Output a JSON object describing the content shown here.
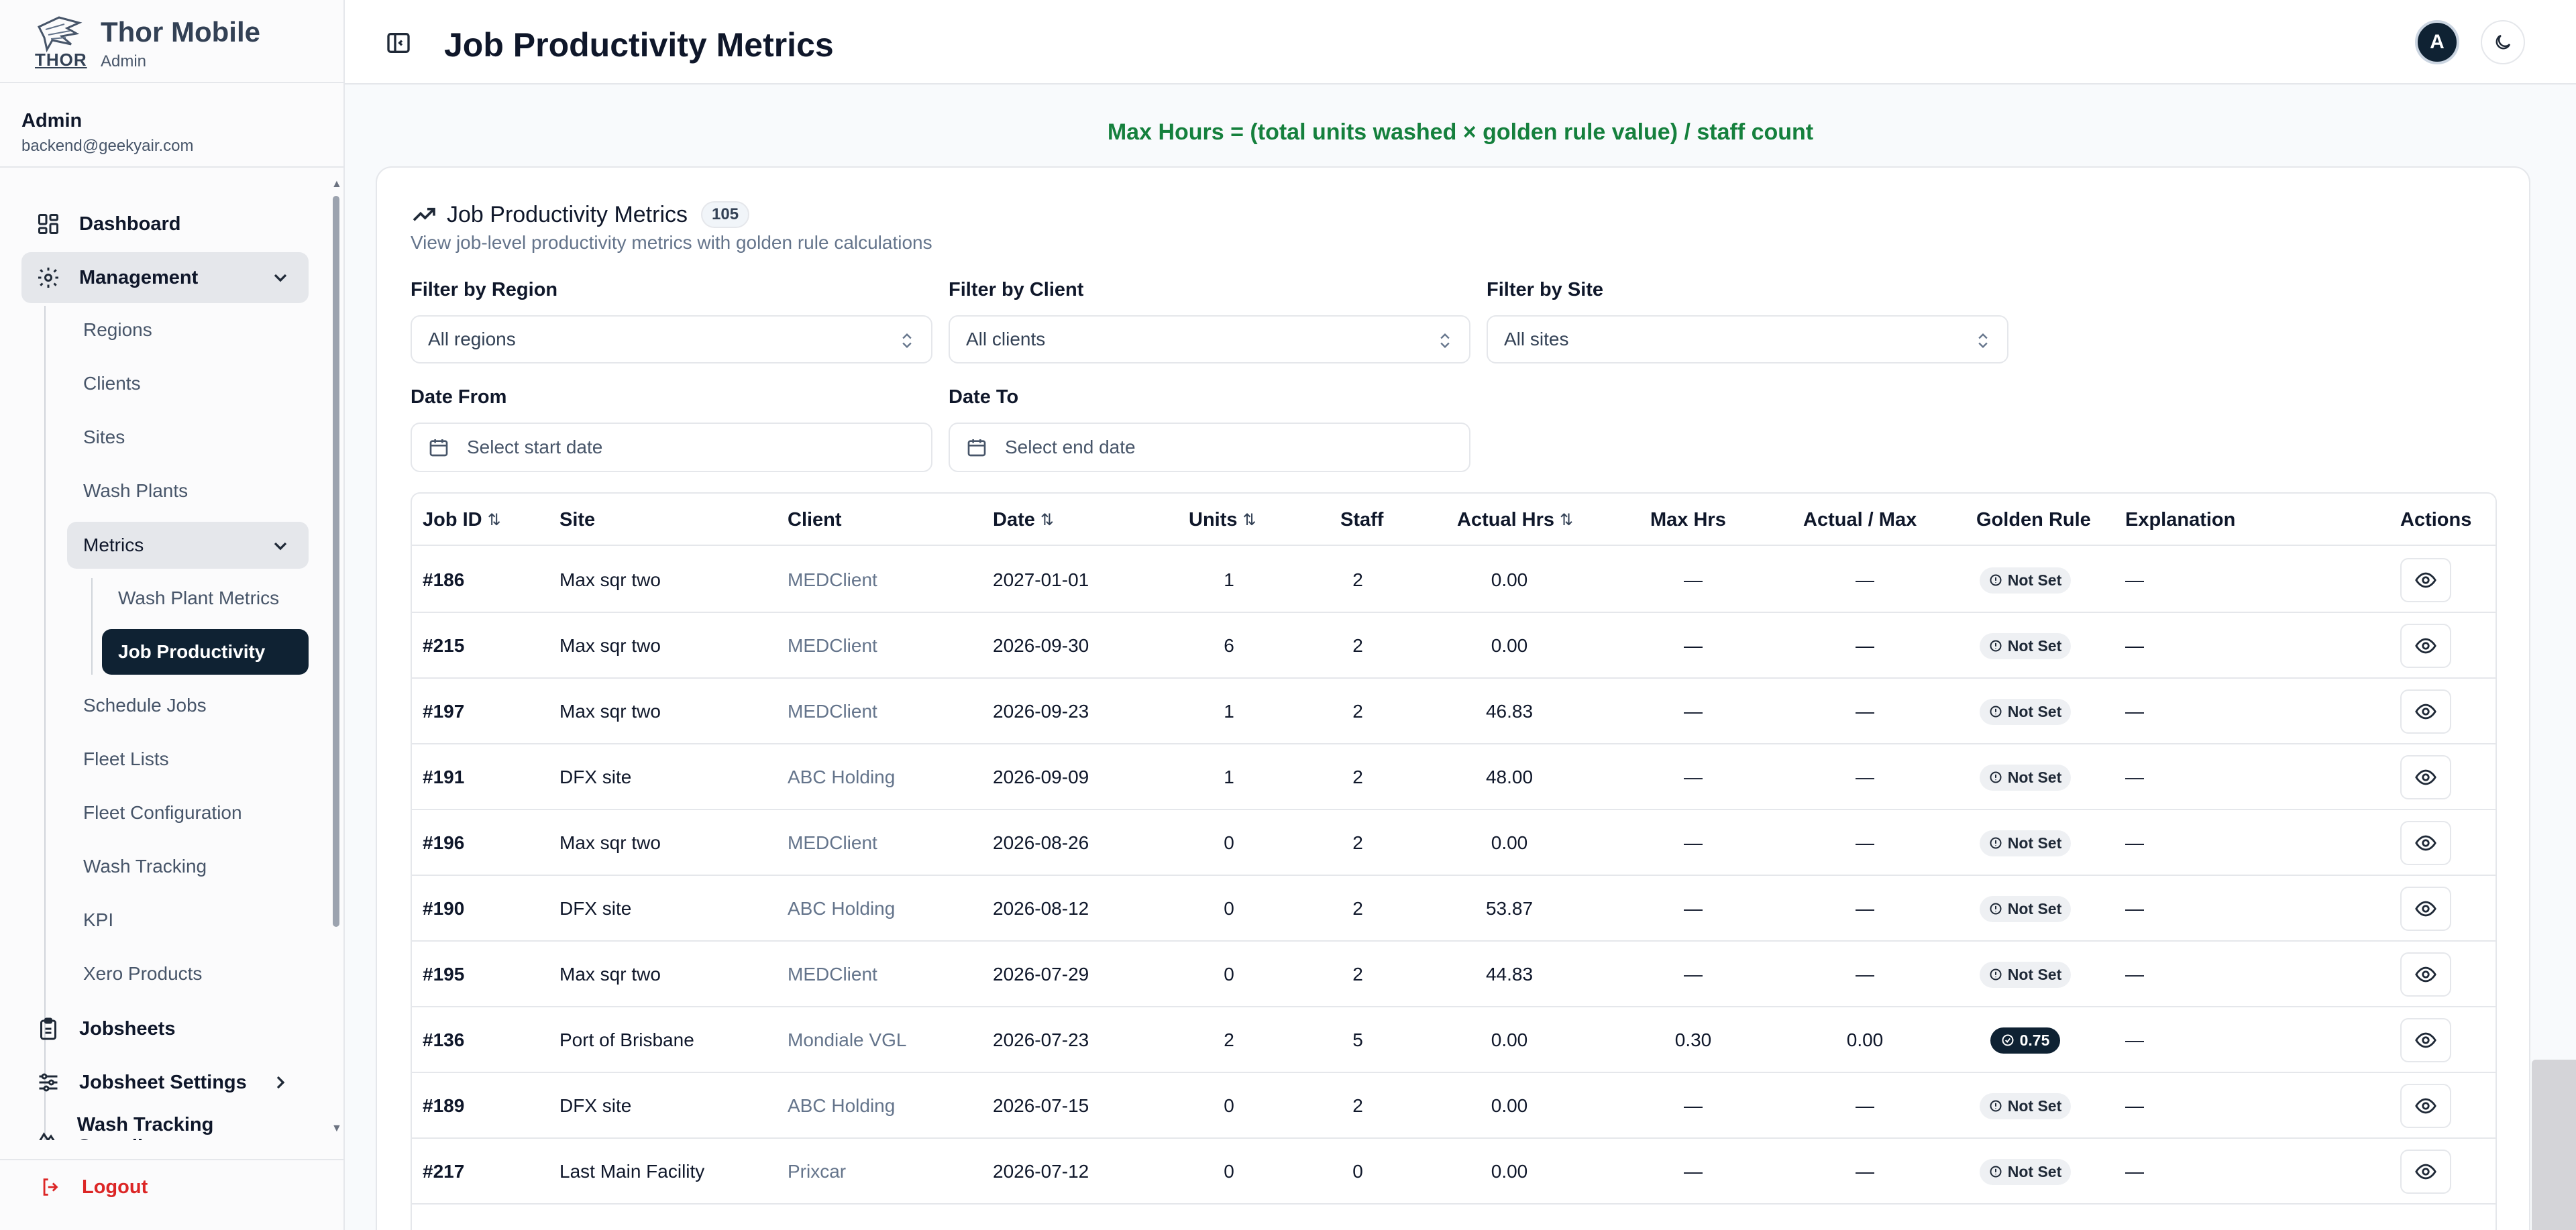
{
  "brand": {
    "logo_text": "THOR",
    "title": "Thor Mobile",
    "subtitle": "Admin"
  },
  "user": {
    "name": "Admin",
    "email": "backend@geekyair.com"
  },
  "nav": {
    "dashboard": "Dashboard",
    "management": "Management",
    "management_items": [
      "Regions",
      "Clients",
      "Sites",
      "Wash Plants"
    ],
    "metrics": "Metrics",
    "metrics_items": [
      "Wash Plant Metrics",
      "Job Productivity"
    ],
    "more_items": [
      "Schedule Jobs",
      "Fleet Lists",
      "Fleet Configuration",
      "Wash Tracking",
      "KPI",
      "Xero Products"
    ],
    "jobsheets": "Jobsheets",
    "jobsheet_settings": "Jobsheet Settings",
    "wash_tracking_compliance": "Wash Tracking Compliance",
    "logout": "Logout"
  },
  "header": {
    "title": "Job Productivity Metrics",
    "avatar_initial": "A"
  },
  "formula": "Max Hours = (total units washed × golden rule value) / staff count",
  "card": {
    "title": "Job Productivity Metrics",
    "count": "105",
    "description": "View job-level productivity metrics with golden rule calculations"
  },
  "filters": {
    "region_label": "Filter by Region",
    "region_value": "All regions",
    "client_label": "Filter by Client",
    "client_value": "All clients",
    "site_label": "Filter by Site",
    "site_value": "All sites",
    "date_from_label": "Date From",
    "date_from_placeholder": "Select start date",
    "date_to_label": "Date To",
    "date_to_placeholder": "Select end date"
  },
  "table": {
    "headers": {
      "job_id": "Job ID",
      "site": "Site",
      "client": "Client",
      "date": "Date",
      "units": "Units",
      "staff": "Staff",
      "actual_hrs": "Actual Hrs",
      "max_hrs": "Max Hrs",
      "actual_max": "Actual / Max",
      "golden_rule": "Golden Rule",
      "explanation": "Explanation",
      "actions": "Actions"
    },
    "rows": [
      {
        "job_id": "#186",
        "site": "Max sqr two",
        "client": "MEDClient",
        "date": "2027-01-01",
        "units": "1",
        "staff": "2",
        "actual_hrs": "0.00",
        "max_hrs": "—",
        "actual_max": "—",
        "golden_rule": "Not Set",
        "golden_set": false,
        "explanation": "—"
      },
      {
        "job_id": "#215",
        "site": "Max sqr two",
        "client": "MEDClient",
        "date": "2026-09-30",
        "units": "6",
        "staff": "2",
        "actual_hrs": "0.00",
        "max_hrs": "—",
        "actual_max": "—",
        "golden_rule": "Not Set",
        "golden_set": false,
        "explanation": "—"
      },
      {
        "job_id": "#197",
        "site": "Max sqr two",
        "client": "MEDClient",
        "date": "2026-09-23",
        "units": "1",
        "staff": "2",
        "actual_hrs": "46.83",
        "max_hrs": "—",
        "actual_max": "—",
        "golden_rule": "Not Set",
        "golden_set": false,
        "explanation": "—"
      },
      {
        "job_id": "#191",
        "site": "DFX site",
        "client": "ABC Holding",
        "date": "2026-09-09",
        "units": "1",
        "staff": "2",
        "actual_hrs": "48.00",
        "max_hrs": "—",
        "actual_max": "—",
        "golden_rule": "Not Set",
        "golden_set": false,
        "explanation": "—"
      },
      {
        "job_id": "#196",
        "site": "Max sqr two",
        "client": "MEDClient",
        "date": "2026-08-26",
        "units": "0",
        "staff": "2",
        "actual_hrs": "0.00",
        "max_hrs": "—",
        "actual_max": "—",
        "golden_rule": "Not Set",
        "golden_set": false,
        "explanation": "—"
      },
      {
        "job_id": "#190",
        "site": "DFX site",
        "client": "ABC Holding",
        "date": "2026-08-12",
        "units": "0",
        "staff": "2",
        "actual_hrs": "53.87",
        "max_hrs": "—",
        "actual_max": "—",
        "golden_rule": "Not Set",
        "golden_set": false,
        "explanation": "—"
      },
      {
        "job_id": "#195",
        "site": "Max sqr two",
        "client": "MEDClient",
        "date": "2026-07-29",
        "units": "0",
        "staff": "2",
        "actual_hrs": "44.83",
        "max_hrs": "—",
        "actual_max": "—",
        "golden_rule": "Not Set",
        "golden_set": false,
        "explanation": "—"
      },
      {
        "job_id": "#136",
        "site": "Port of Brisbane",
        "client": "Mondiale VGL",
        "date": "2026-07-23",
        "units": "2",
        "staff": "5",
        "actual_hrs": "0.00",
        "max_hrs": "0.30",
        "actual_max": "0.00",
        "golden_rule": "0.75",
        "golden_set": true,
        "explanation": "—"
      },
      {
        "job_id": "#189",
        "site": "DFX site",
        "client": "ABC Holding",
        "date": "2026-07-15",
        "units": "0",
        "staff": "2",
        "actual_hrs": "0.00",
        "max_hrs": "—",
        "actual_max": "—",
        "golden_rule": "Not Set",
        "golden_set": false,
        "explanation": "—"
      },
      {
        "job_id": "#217",
        "site": "Last Main Facility",
        "client": "Prixcar",
        "date": "2026-07-12",
        "units": "0",
        "staff": "0",
        "actual_hrs": "0.00",
        "max_hrs": "—",
        "actual_max": "—",
        "golden_rule": "Not Set",
        "golden_set": false,
        "explanation": "—"
      }
    ]
  },
  "colors": {
    "accent_dark": "#0f2233",
    "formula_green": "#15803d",
    "logout_red": "#dc2626"
  }
}
